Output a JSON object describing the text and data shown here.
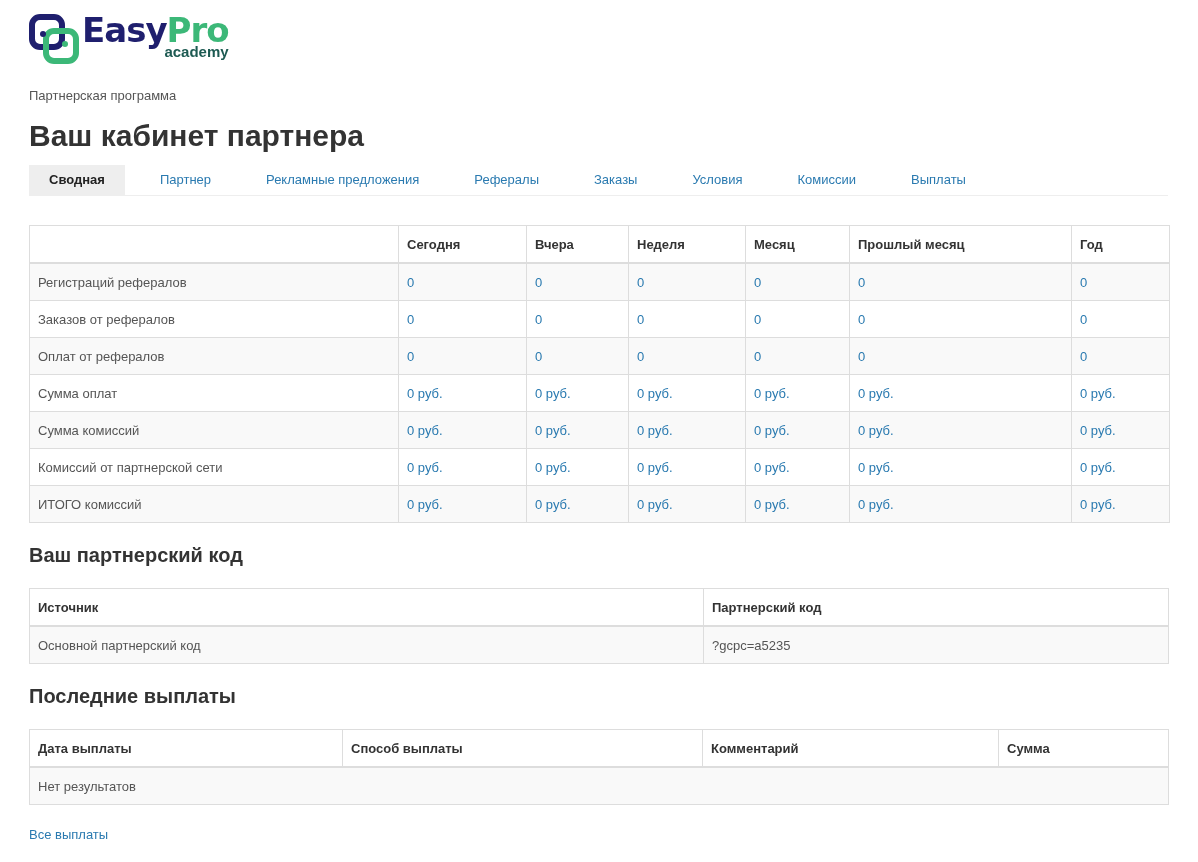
{
  "logo": {
    "word_1": "Easy",
    "word_2": "Pro",
    "tagline": "academy"
  },
  "breadcrumb": "Партнерская программа",
  "title": "Ваш кабинет партнера",
  "tabs": [
    {
      "label": "Сводная",
      "selected": true
    },
    {
      "label": "Партнер",
      "selected": false
    },
    {
      "label": "Рекламные предложения",
      "selected": false
    },
    {
      "label": "Рефералы",
      "selected": false
    },
    {
      "label": "Заказы",
      "selected": false
    },
    {
      "label": "Условия",
      "selected": false
    },
    {
      "label": "Комиссии",
      "selected": false
    },
    {
      "label": "Выплаты",
      "selected": false
    }
  ],
  "stats_table": {
    "columns": [
      "",
      "Сегодня",
      "Вчера",
      "Неделя",
      "Месяц",
      "Прошлый месяц",
      "Год"
    ],
    "rows": [
      {
        "label": "Регистраций рефералов",
        "values": [
          "0",
          "0",
          "0",
          "0",
          "0",
          "0"
        ]
      },
      {
        "label": "Заказов от рефералов",
        "values": [
          "0",
          "0",
          "0",
          "0",
          "0",
          "0"
        ]
      },
      {
        "label": "Оплат от рефералов",
        "values": [
          "0",
          "0",
          "0",
          "0",
          "0",
          "0"
        ]
      },
      {
        "label": "Сумма оплат",
        "values": [
          "0 руб.",
          "0 руб.",
          "0 руб.",
          "0 руб.",
          "0 руб.",
          "0 руб."
        ]
      },
      {
        "label": "Сумма комиссий",
        "values": [
          "0 руб.",
          "0 руб.",
          "0 руб.",
          "0 руб.",
          "0 руб.",
          "0 руб."
        ]
      },
      {
        "label": "Комиссий от партнерской сети",
        "values": [
          "0 руб.",
          "0 руб.",
          "0 руб.",
          "0 руб.",
          "0 руб.",
          "0 руб."
        ]
      },
      {
        "label": "ИТОГО комиссий",
        "values": [
          "0 руб.",
          "0 руб.",
          "0 руб.",
          "0 руб.",
          "0 руб.",
          "0 руб."
        ]
      }
    ]
  },
  "code_section": {
    "heading": "Ваш партнерский код",
    "columns": [
      "Источник",
      "Партнерский код"
    ],
    "rows": [
      [
        "Основной партнерский код",
        "?gcpc=a5235"
      ]
    ]
  },
  "payments_section": {
    "heading": "Последние выплаты",
    "columns": [
      "Дата выплаты",
      "Способ выплаты",
      "Комментарий",
      "Сумма"
    ],
    "empty_text": "Нет результатов",
    "all_link": "Все выплаты"
  }
}
